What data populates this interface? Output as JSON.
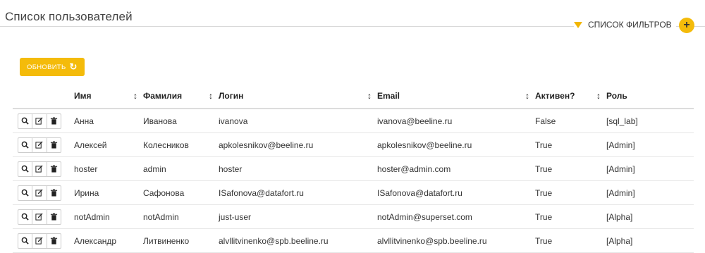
{
  "header": {
    "title": "Список пользователей",
    "filters_label": "СПИСОК ФИЛЬТРОВ",
    "add_label": "+"
  },
  "toolbar": {
    "refresh_label": "ОБНОВИТЬ"
  },
  "table": {
    "columns": [
      "Имя",
      "Фамилия",
      "Логин",
      "Email",
      "Активен?",
      "Роль"
    ],
    "rows": [
      {
        "first": "Анна",
        "last": "Иванова",
        "login": "ivanova",
        "email": "ivanova@beeline.ru",
        "active": "False",
        "role": "[sql_lab]"
      },
      {
        "first": "Алексей",
        "last": "Колесников",
        "login": "apkolesnikov@beeline.ru",
        "email": "apkolesnikov@beeline.ru",
        "active": "True",
        "role": "[Admin]"
      },
      {
        "first": "hoster",
        "last": "admin",
        "login": "hoster",
        "email": "hoster@admin.com",
        "active": "True",
        "role": "[Admin]"
      },
      {
        "first": "Ирина",
        "last": "Сафонова",
        "login": "ISafonova@datafort.ru",
        "email": "ISafonova@datafort.ru",
        "active": "True",
        "role": "[Admin]"
      },
      {
        "first": "notAdmin",
        "last": "notAdmin",
        "login": "just-user",
        "email": "notAdmin@superset.com",
        "active": "True",
        "role": "[Alpha]"
      },
      {
        "first": "Александр",
        "last": "Литвиненко",
        "login": "alvllitvinenko@spb.beeline.ru",
        "email": "alvllitvinenko@spb.beeline.ru",
        "active": "True",
        "role": "[Alpha]"
      }
    ]
  },
  "icons": {
    "view": "search-icon",
    "edit": "edit-icon",
    "delete": "trash-icon",
    "sort": "sort-icon",
    "filter": "funnel-icon",
    "refresh": "refresh-icon"
  },
  "colors": {
    "accent": "#f4bb0a"
  }
}
